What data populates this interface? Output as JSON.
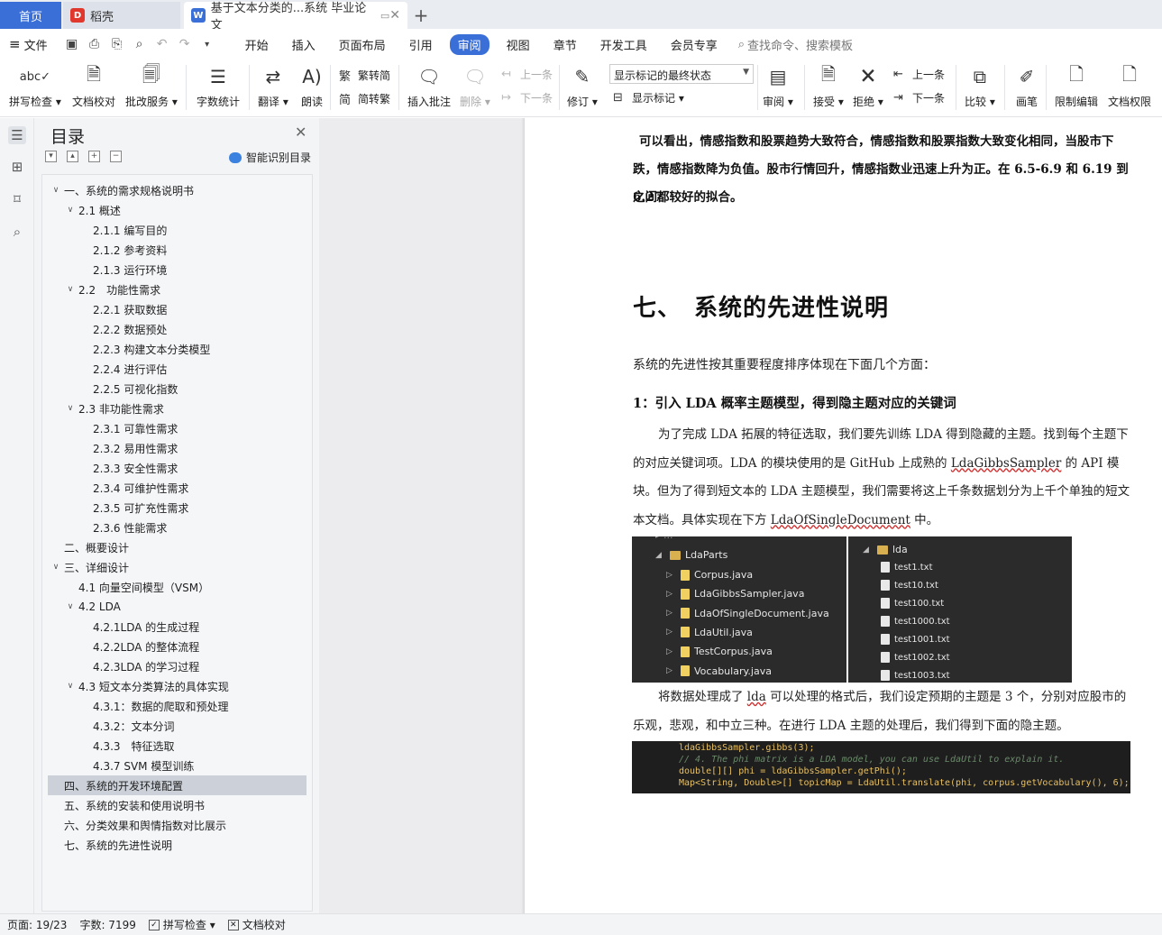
{
  "titlebar": {
    "home_tab": "首页",
    "daoke_tab": "稻壳",
    "doc_tab": "基于文本分类的...系统 毕业论文",
    "add_tab": "+"
  },
  "menubar": {
    "file": "文件",
    "items": [
      "开始",
      "插入",
      "页面布局",
      "引用",
      "审阅",
      "视图",
      "章节",
      "开发工具",
      "会员专享"
    ],
    "active_item": "审阅",
    "search": "查找命令、搜索模板"
  },
  "ribbon": {
    "spell_check": "拼写检查",
    "doc_proof": "文档校对",
    "batch_service": "批改服务",
    "word_count": "字数统计",
    "translate": "翻译",
    "read_aloud": "朗读",
    "trad_conv": "繁转简",
    "simp_conv": "简转繁",
    "insert_comment": "插入批注",
    "delete": "删除",
    "prev": "上一条",
    "next": "下一条",
    "track_changes": "修订",
    "show_markup_state": "显示标记的最终状态",
    "show_markup": "显示标记",
    "review": "审阅",
    "accept": "接受",
    "reject": "拒绝",
    "prev2": "上一条",
    "next2": "下一条",
    "compare": "比较",
    "pen": "画笔",
    "restrict_edit": "限制编辑",
    "doc_permission": "文档权限"
  },
  "toc": {
    "title": "目录",
    "smart_toc": "智能识别目录",
    "items": [
      {
        "label": "一、系统的需求规格说明书",
        "level": 1,
        "caret": "v"
      },
      {
        "label": "2.1 概述",
        "level": 2,
        "caret": "v"
      },
      {
        "label": "2.1.1 编写目的",
        "level": 3,
        "caret": ""
      },
      {
        "label": "2.1.2 参考资料",
        "level": 3,
        "caret": ""
      },
      {
        "label": "2.1.3 运行环境",
        "level": 3,
        "caret": ""
      },
      {
        "label": "2.2　功能性需求",
        "level": 2,
        "caret": "v"
      },
      {
        "label": "2.2.1 获取数据",
        "level": 3,
        "caret": ""
      },
      {
        "label": "2.2.2 数据预处",
        "level": 3,
        "caret": ""
      },
      {
        "label": "2.2.3 构建文本分类模型",
        "level": 3,
        "caret": ""
      },
      {
        "label": "2.2.4 进行评估",
        "level": 3,
        "caret": ""
      },
      {
        "label": "2.2.5 可视化指数",
        "level": 3,
        "caret": ""
      },
      {
        "label": "2.3 非功能性需求",
        "level": 2,
        "caret": "v"
      },
      {
        "label": "2.3.1 可靠性需求",
        "level": 3,
        "caret": ""
      },
      {
        "label": "2.3.2 易用性需求",
        "level": 3,
        "caret": ""
      },
      {
        "label": "2.3.3 安全性需求",
        "level": 3,
        "caret": ""
      },
      {
        "label": "2.3.4 可维护性需求",
        "level": 3,
        "caret": ""
      },
      {
        "label": "2.3.5 可扩充性需求",
        "level": 3,
        "caret": ""
      },
      {
        "label": "2.3.6 性能需求",
        "level": 3,
        "caret": ""
      },
      {
        "label": "二、概要设计",
        "level": 1,
        "caret": ""
      },
      {
        "label": "三、详细设计",
        "level": 1,
        "caret": "v"
      },
      {
        "label": "4.1 向量空间模型（VSM）",
        "level": 2,
        "caret": ""
      },
      {
        "label": "4.2 LDA",
        "level": 2,
        "caret": "v"
      },
      {
        "label": "4.2.1LDA 的生成过程",
        "level": 3,
        "caret": ""
      },
      {
        "label": "4.2.2LDA 的整体流程",
        "level": 3,
        "caret": ""
      },
      {
        "label": "4.2.3LDA 的学习过程",
        "level": 3,
        "caret": ""
      },
      {
        "label": "4.3 短文本分类算法的具体实现",
        "level": 2,
        "caret": "v"
      },
      {
        "label": "4.3.1：数据的爬取和预处理",
        "level": 3,
        "caret": ""
      },
      {
        "label": "4.3.2：文本分词",
        "level": 3,
        "caret": ""
      },
      {
        "label": "4.3.3　特征选取",
        "level": 3,
        "caret": ""
      },
      {
        "label": "4.3.7 SVM 模型训练",
        "level": 3,
        "caret": ""
      },
      {
        "label": "四、系统的开发环境配置",
        "level": 1,
        "caret": "",
        "selected": true
      },
      {
        "label": "五、系统的安装和使用说明书",
        "level": 1,
        "caret": ""
      },
      {
        "label": "六、分类效果和舆情指数对比展示",
        "level": 1,
        "caret": ""
      },
      {
        "label": "七、系统的先进性说明",
        "level": 1,
        "caret": ""
      }
    ]
  },
  "doc": {
    "para_top_1": "可以看出，情感指数和股票趋势大致符合，情感指数和股票指数大致变化相同，当股市下",
    "para_top_2": "跌，情感指数降为负值。股市行情回升，情感指数业迅速上升为正。在 6.5-6.9 和 6.19 到 6.27",
    "para_top_3": "之间都较好的拟合。",
    "heading7": "七、　系统的先进性说明",
    "intro": "系统的先进性按其重要程度排序体现在下面几个方面：",
    "sub1": "1：引入 LDA 概率主题模型，得到隐主题对应的关键词",
    "p1_a": "为了完成 LDA 拓展的特征选取，我们要先训练 LDA 得到隐藏的主题。找到每个主题下的对应关键词项。LDA 的模块使用的是 GitHub 上成熟的 ",
    "p1_b": "LdaGibbsSampler",
    "p1_c": " 的 API 模块。但为了得到短文本的 LDA 主题模型，我们需要将这上千条数据划分为上千个单独的短文本文档。具体实现在下方 ",
    "p1_d": "LdaOfSingleDocument",
    "p1_e": " 中。",
    "p2_a": "将数据处理成了 ",
    "p2_b": "lda",
    "p2_c": " 可以处理的格式后，我们设定预期的主题是 3 个，分别对应股市的乐观，悲观，和中立三种。在进行 LDA 主题的处理后，我们得到下面的隐主题。",
    "tree_left": {
      "package": "LdaParts",
      "files": [
        "Corpus.java",
        "LdaGibbsSampler.java",
        "LdaOfSingleDocument.java",
        "LdaUtil.java",
        "TestCorpus.java",
        "Vocabulary.java"
      ]
    },
    "tree_right": {
      "folder": "lda",
      "files": [
        "test1.txt",
        "test10.txt",
        "test100.txt",
        "test1000.txt",
        "test1001.txt",
        "test1002.txt",
        "test1003.txt"
      ]
    },
    "code_lines": [
      "ldaGibbsSampler.gibbs(3);",
      "// 4. The phi matrix is a LDA model, you can use LdaUtil to explain it.",
      "double[][] phi = ldaGibbsSampler.getPhi();",
      "Map<String, Double>[] topicMap = LdaUtil.translate(phi, corpus.getVocabulary(), 6);"
    ]
  },
  "status": {
    "page": "页面: 19/23",
    "words": "字数: 7199",
    "spell": "拼写检查",
    "proof": "文档校对"
  },
  "colors": {
    "accent": "#3b6fd8",
    "toc_selected": "#ccd1d9",
    "code_bg": "#1e1e1e"
  }
}
